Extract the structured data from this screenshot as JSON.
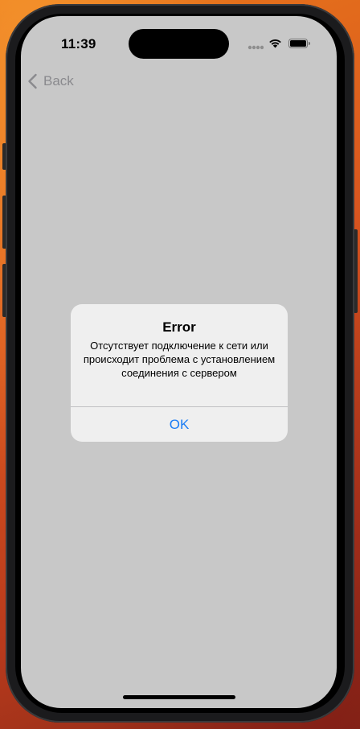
{
  "status_bar": {
    "time": "11:39",
    "signal_icon": "cellular-signal-icon",
    "wifi_icon": "wifi-icon",
    "battery_icon": "battery-icon"
  },
  "nav": {
    "back_label": "Back",
    "back_icon": "chevron-left-icon"
  },
  "alert": {
    "title": "Error",
    "message": "Отсутствует подключение к сети или происходит проблема с установлением соединения с сервером",
    "ok_label": "OK"
  },
  "colors": {
    "screen_background": "#c8c8c8",
    "alert_background": "#f0f0f0",
    "accent": "#1a7cf5",
    "back_gray": "#8a8a8e"
  }
}
